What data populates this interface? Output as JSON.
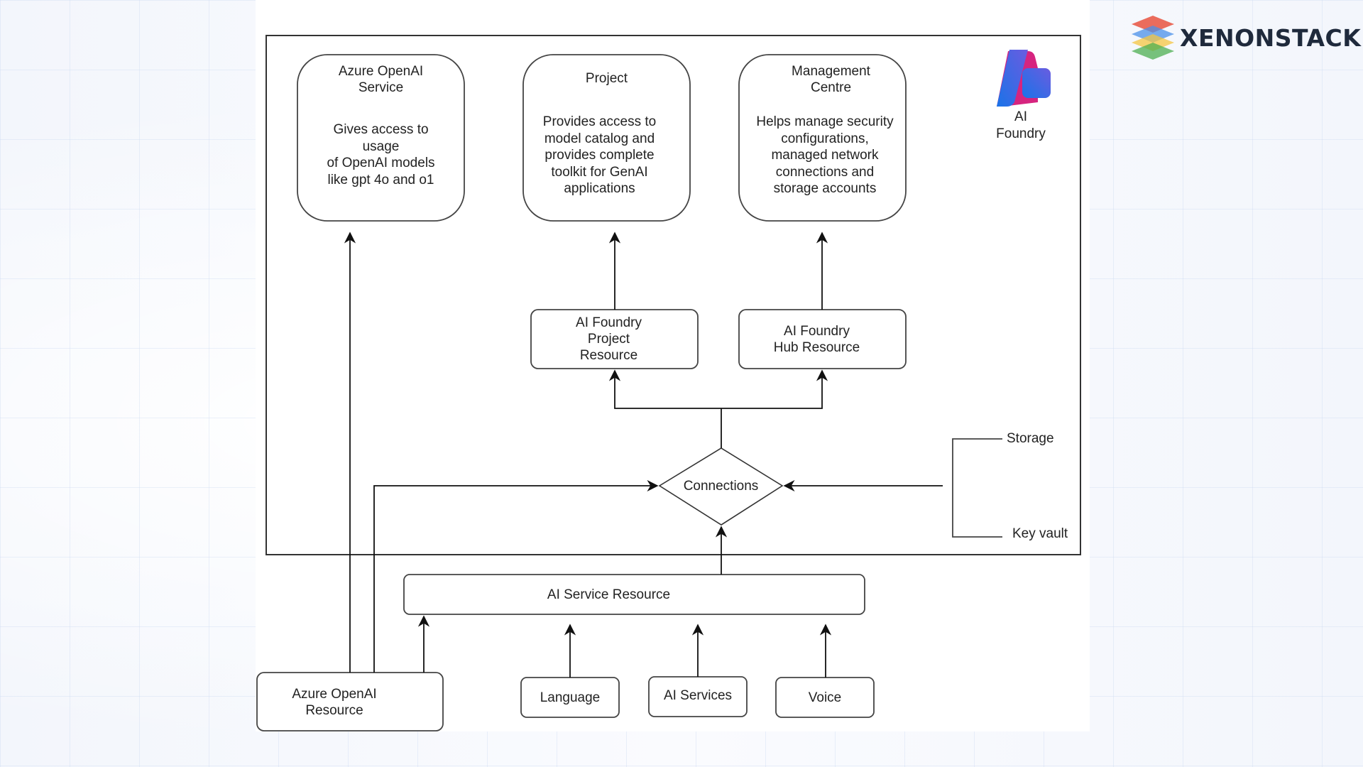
{
  "brand": {
    "name": "XENONSTACK",
    "logo_icon": "layered-stack-icon",
    "colors": {
      "red": "#e8533f",
      "blue": "#4a90e8",
      "yellow": "#f4c542",
      "green": "#4caf50",
      "text": "#1f2a3c"
    }
  },
  "platform": {
    "icon": "ai-foundry-icon",
    "caption": "AI\nFoundry",
    "icon_colors": {
      "blue": "#1a73e8",
      "magenta": "#d6247f",
      "violet": "#6a5ce0"
    }
  },
  "top_boxes": [
    {
      "title": "Azure OpenAI\nService",
      "description": "Gives access to\nusage\nof OpenAI models\nlike gpt 4o and o1"
    },
    {
      "title": "Project",
      "description": "Provides access to\nmodel catalog and\nprovides complete\ntoolkit for GenAI\napplications"
    },
    {
      "title": "Management\nCentre",
      "description": "Helps manage security\nconfigurations,\nmanaged network\nconnections and\nstorage accounts"
    }
  ],
  "resources": {
    "project_resource": "AI Foundry\nProject\nResource",
    "hub_resource": "AI Foundry\nHub Resource",
    "connections": "Connections",
    "ai_service_resource": "AI Service Resource",
    "azure_openai_resource": "Azure OpenAI\nResource"
  },
  "side_connections": [
    "Storage",
    "Key vault"
  ],
  "services": [
    "Language",
    "AI Services",
    "Voice"
  ]
}
